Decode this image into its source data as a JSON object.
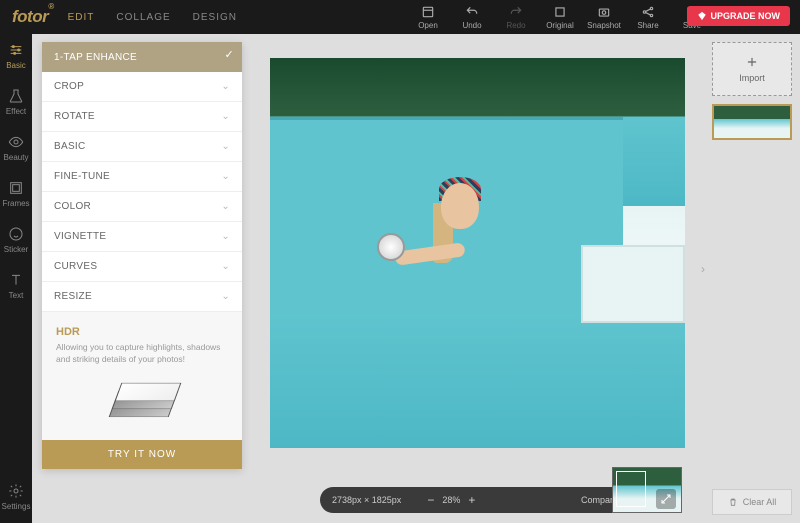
{
  "brand": "fotor",
  "tabs": [
    {
      "label": "EDIT",
      "active": true
    },
    {
      "label": "COLLAGE",
      "active": false
    },
    {
      "label": "DESIGN",
      "active": false
    }
  ],
  "topIcons": [
    {
      "name": "open",
      "label": "Open"
    },
    {
      "name": "undo",
      "label": "Undo"
    },
    {
      "name": "redo",
      "label": "Redo",
      "disabled": true
    },
    {
      "name": "original",
      "label": "Original"
    },
    {
      "name": "snapshot",
      "label": "Snapshot"
    },
    {
      "name": "share",
      "label": "Share"
    },
    {
      "name": "save",
      "label": "Save"
    }
  ],
  "upgrade": "UPGRADE NOW",
  "leftTools": [
    {
      "name": "basic",
      "label": "Basic",
      "active": true
    },
    {
      "name": "effect",
      "label": "Effect"
    },
    {
      "name": "beauty",
      "label": "Beauty"
    },
    {
      "name": "frames",
      "label": "Frames"
    },
    {
      "name": "sticker",
      "label": "Sticker"
    },
    {
      "name": "text",
      "label": "Text"
    }
  ],
  "settingsLabel": "Settings",
  "panel": {
    "items": [
      {
        "label": "1-Tap Enhance",
        "selected": true
      },
      {
        "label": "Crop"
      },
      {
        "label": "Rotate"
      },
      {
        "label": "Basic"
      },
      {
        "label": "Fine-Tune"
      },
      {
        "label": "Color"
      },
      {
        "label": "Vignette"
      },
      {
        "label": "Curves"
      },
      {
        "label": "Resize"
      }
    ],
    "hdr": {
      "title": "HDR",
      "desc": "Allowing you to capture highlights, shadows and striking details of your photos!",
      "cta": "TRY IT NOW"
    }
  },
  "import": "Import",
  "clearAll": "Clear All",
  "status": {
    "dims": "2738px × 1825px",
    "zoom": "28%",
    "compare": "Compare"
  }
}
